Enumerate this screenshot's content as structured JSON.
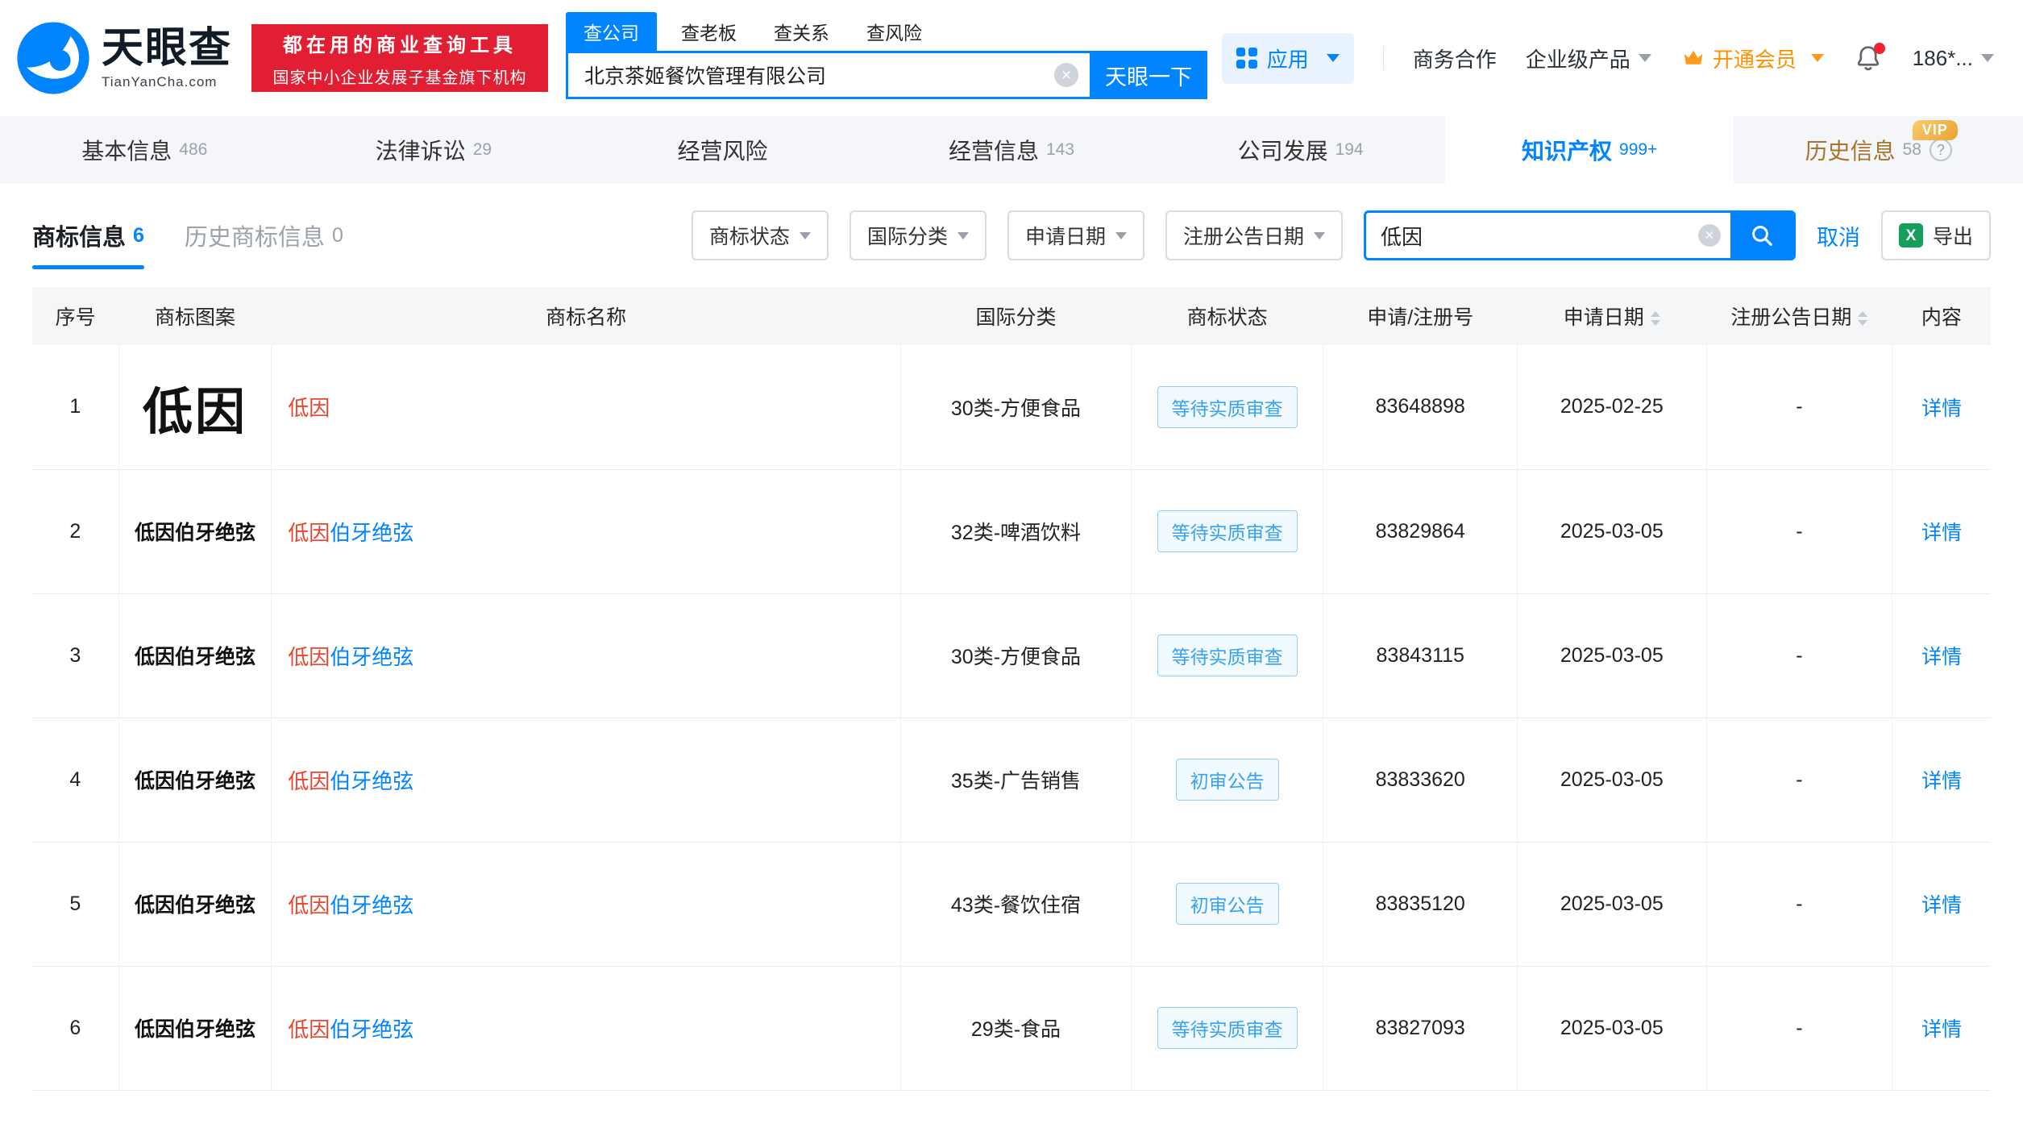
{
  "brand": {
    "name": "天眼查",
    "domain": "TianYanCha.com",
    "banner_line1": "都在用的商业查询工具",
    "banner_line2": "国家中小企业发展子基金旗下机构"
  },
  "top_search": {
    "tabs": [
      {
        "key": "company",
        "label": "查公司",
        "active": true
      },
      {
        "key": "boss",
        "label": "查老板"
      },
      {
        "key": "relation",
        "label": "查关系"
      },
      {
        "key": "risk",
        "label": "查风险"
      }
    ],
    "value": "北京茶姬餐饮管理有限公司",
    "button": "天眼一下"
  },
  "top_nav": {
    "apps": "应用",
    "biz": "商务合作",
    "enterprise": "企业级产品",
    "vip": "开通会员",
    "user": "186*..."
  },
  "nav_tabs": [
    {
      "key": "basic-info",
      "label": "基本信息",
      "count": "486"
    },
    {
      "key": "legal-proceedings",
      "label": "法律诉讼",
      "count": "29"
    },
    {
      "key": "business-risk",
      "label": "经营风险",
      "count": ""
    },
    {
      "key": "business-info",
      "label": "经营信息",
      "count": "143"
    },
    {
      "key": "company-development",
      "label": "公司发展",
      "count": "194"
    },
    {
      "key": "intellectual-property",
      "label": "知识产权",
      "count": "999+",
      "active": true
    },
    {
      "key": "history-info",
      "label": "历史信息",
      "count": "58",
      "gold": true,
      "vip": "VIP",
      "help": "?"
    }
  ],
  "section": {
    "subtabs": [
      {
        "key": "trademark-info",
        "label": "商标信息",
        "count": "6",
        "active": true
      },
      {
        "key": "history-trademark-info",
        "label": "历史商标信息",
        "count": "0"
      }
    ],
    "filters": [
      {
        "key": "trademark-status",
        "label": "商标状态"
      },
      {
        "key": "intl-class",
        "label": "国际分类"
      },
      {
        "key": "apply-date",
        "label": "申请日期"
      },
      {
        "key": "reg-announce-date",
        "label": "注册公告日期"
      }
    ],
    "search_value": "低因",
    "cancel": "取消",
    "export": "导出"
  },
  "table": {
    "columns": [
      {
        "key": "seq",
        "label": "序号"
      },
      {
        "key": "trademark-image",
        "label": "商标图案"
      },
      {
        "key": "trademark-name",
        "label": "商标名称"
      },
      {
        "key": "intl-class",
        "label": "国际分类"
      },
      {
        "key": "trademark-status",
        "label": "商标状态"
      },
      {
        "key": "application-number",
        "label": "申请/注册号"
      },
      {
        "key": "application-date",
        "label": "申请日期",
        "sortable": true
      },
      {
        "key": "registration-announce-date",
        "label": "注册公告日期",
        "sortable": true
      },
      {
        "key": "content",
        "label": "内容"
      }
    ],
    "rows": [
      {
        "seq": "1",
        "image_text": "低因",
        "name_highlight": "低因",
        "name_rest": "",
        "category": "30类-方便食品",
        "status": "等待实质审查",
        "app_no": "83648898",
        "app_date": "2025-02-25",
        "reg_date": "-",
        "action": "详情"
      },
      {
        "seq": "2",
        "image_text": "低因伯牙绝弦",
        "name_highlight": "低因",
        "name_rest": "伯牙绝弦",
        "category": "32类-啤酒饮料",
        "status": "等待实质审查",
        "app_no": "83829864",
        "app_date": "2025-03-05",
        "reg_date": "-",
        "action": "详情"
      },
      {
        "seq": "3",
        "image_text": "低因伯牙绝弦",
        "name_highlight": "低因",
        "name_rest": "伯牙绝弦",
        "category": "30类-方便食品",
        "status": "等待实质审查",
        "app_no": "83843115",
        "app_date": "2025-03-05",
        "reg_date": "-",
        "action": "详情"
      },
      {
        "seq": "4",
        "image_text": "低因伯牙绝弦",
        "name_highlight": "低因",
        "name_rest": "伯牙绝弦",
        "category": "35类-广告销售",
        "status": "初审公告",
        "app_no": "83833620",
        "app_date": "2025-03-05",
        "reg_date": "-",
        "action": "详情"
      },
      {
        "seq": "5",
        "image_text": "低因伯牙绝弦",
        "name_highlight": "低因",
        "name_rest": "伯牙绝弦",
        "category": "43类-餐饮住宿",
        "status": "初审公告",
        "app_no": "83835120",
        "app_date": "2025-03-05",
        "reg_date": "-",
        "action": "详情"
      },
      {
        "seq": "6",
        "image_text": "低因伯牙绝弦",
        "name_highlight": "低因",
        "name_rest": "伯牙绝弦",
        "category": "29类-食品",
        "status": "等待实质审查",
        "app_no": "83827093",
        "app_date": "2025-03-05",
        "reg_date": "-",
        "action": "详情"
      }
    ]
  },
  "icons": {
    "clear": "×",
    "excel": "X"
  },
  "colors": {
    "brand_blue": "#0084ff",
    "banner_red": "#e11e32",
    "highlight_red": "#f0432c",
    "link_blue": "#0084ff",
    "vip_orange": "#ff9b1a",
    "status_blue": "#39a1f2",
    "tab_bar_gray": "#f4f6f9"
  }
}
